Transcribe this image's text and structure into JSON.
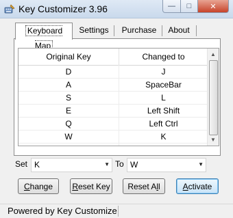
{
  "window": {
    "title": "Key Customizer 3.96",
    "controls": {
      "minimize": "—",
      "maximize": "□",
      "close": "✕"
    }
  },
  "tabs": [
    {
      "label": "Keyboard Map",
      "active": true
    },
    {
      "label": "Settings",
      "active": false
    },
    {
      "label": "Purchase",
      "active": false
    },
    {
      "label": "About",
      "active": false
    }
  ],
  "list": {
    "columns": [
      "Original Key",
      "Changed to"
    ],
    "rows": [
      [
        "D",
        "J"
      ],
      [
        "A",
        "SpaceBar"
      ],
      [
        "S",
        "L"
      ],
      [
        "E",
        "Left Shift"
      ],
      [
        "Q",
        "Left Ctrl"
      ],
      [
        "W",
        "K"
      ]
    ]
  },
  "mapping": {
    "set_label": "Set",
    "set_value": "K",
    "to_label": "To",
    "to_value": "W"
  },
  "buttons": {
    "change": {
      "first": "C",
      "rest": "hange"
    },
    "reset_key": {
      "first": "R",
      "rest": "eset Key"
    },
    "reset_all": {
      "pre": "Reset A",
      "ul": "l",
      "post": "l"
    },
    "activate": {
      "first": "A",
      "rest": "ctivate"
    }
  },
  "status": {
    "text": "Powered by Key Customize"
  }
}
